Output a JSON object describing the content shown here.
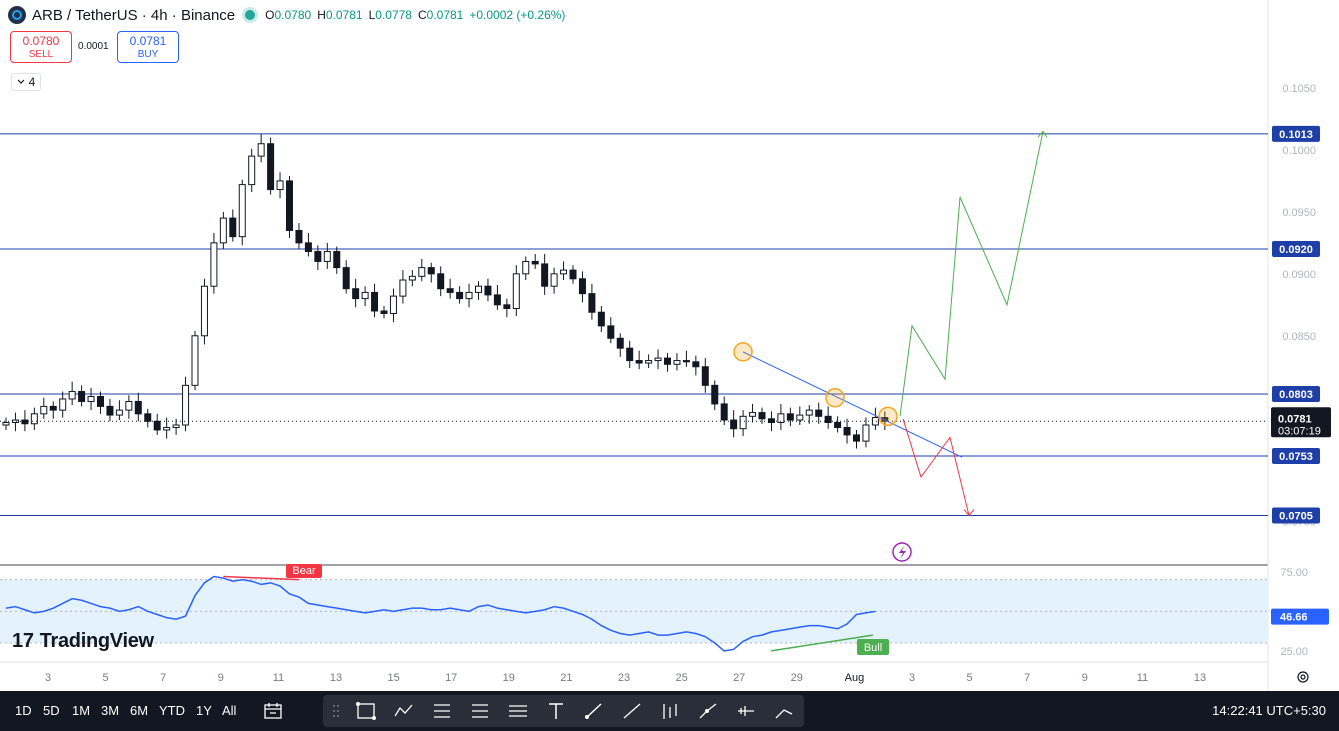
{
  "header": {
    "symbol": "ARB / TetherUS · 4h · Binance",
    "open_label": "O",
    "open": "0.0780",
    "high_label": "H",
    "high": "0.0781",
    "low_label": "L",
    "low": "0.0778",
    "close_label": "C",
    "close": "0.0781",
    "change": "+0.0002 (+0.26%)"
  },
  "trade": {
    "sell_price": "0.0780",
    "sell_label": "SELL",
    "spread": "0.0001",
    "buy_price": "0.0781",
    "buy_label": "BUY"
  },
  "indicator_count": "4",
  "logo_text": "TradingView",
  "colors": {
    "up": "#131722",
    "down": "#131722",
    "level_line": "#1e3fa8",
    "trendline": "#2962ff",
    "bull_path": "#4caf50",
    "bear_path": "#f23645",
    "rsi_line": "#2962ff",
    "rsi_band": "#e3f2fd",
    "circle": "#f5a623",
    "event": "#9c27b0"
  },
  "chart_data": [
    {
      "type": "candlestick",
      "symbol": "ARB / TetherUS",
      "timeframe": "4h",
      "ylim": [
        0.0665,
        0.1075
      ],
      "y_ticks": [
        "0.1050",
        "0.1000",
        "0.0950",
        "0.0900",
        "0.0850",
        "0.0800",
        "0.0750",
        "0.0700"
      ],
      "x_ticks": [
        "3",
        "5",
        "7",
        "9",
        "11",
        "13",
        "15",
        "17",
        "19",
        "21",
        "23",
        "25",
        "27",
        "29",
        "Aug",
        "3",
        "5",
        "7",
        "9",
        "11",
        "13"
      ],
      "key_levels": [
        "0.1013",
        "0.0920",
        "0.0803",
        "0.0753",
        "0.0705"
      ],
      "last_price": "0.0781",
      "countdown": "03:07:19",
      "closes": [
        0.078,
        0.0782,
        0.0779,
        0.0787,
        0.0793,
        0.079,
        0.0799,
        0.0805,
        0.0797,
        0.0801,
        0.0793,
        0.0786,
        0.079,
        0.0797,
        0.0787,
        0.0781,
        0.0774,
        0.0776,
        0.0778,
        0.081,
        0.085,
        0.089,
        0.0925,
        0.0945,
        0.093,
        0.0972,
        0.0995,
        0.1005,
        0.0968,
        0.0975,
        0.0935,
        0.0925,
        0.0918,
        0.091,
        0.0918,
        0.0905,
        0.0888,
        0.088,
        0.0885,
        0.087,
        0.0868,
        0.0882,
        0.0895,
        0.0898,
        0.0905,
        0.09,
        0.0888,
        0.0885,
        0.088,
        0.0885,
        0.089,
        0.0883,
        0.0875,
        0.0872,
        0.09,
        0.091,
        0.0908,
        0.089,
        0.09,
        0.0903,
        0.0896,
        0.0884,
        0.0869,
        0.0858,
        0.0848,
        0.084,
        0.083,
        0.0828,
        0.083,
        0.0832,
        0.0827,
        0.083,
        0.0829,
        0.0825,
        0.081,
        0.0795,
        0.0782,
        0.0775,
        0.0785,
        0.0788,
        0.0783,
        0.078,
        0.0787,
        0.0782,
        0.0786,
        0.079,
        0.0785,
        0.078,
        0.0776,
        0.077,
        0.0765,
        0.0778,
        0.0784,
        0.0781
      ],
      "trendline": {
        "from": [
          0.0837,
          0.0808
        ],
        "to": [
          0.0808,
          0.0752
        ]
      },
      "touch_circles": [
        0.0837,
        0.08,
        0.0785
      ],
      "projection_bull": [
        0.0785,
        0.0858,
        0.0815,
        0.0962,
        0.0875,
        0.1015
      ],
      "projection_bear": [
        0.0783,
        0.0736,
        0.0768,
        0.0705
      ]
    },
    {
      "type": "line",
      "name": "RSI",
      "ylim": [
        18,
        78
      ],
      "y_ticks": [
        "75.00",
        "25.00"
      ],
      "band": [
        30,
        70
      ],
      "last_value": "46.66",
      "values": [
        52,
        53,
        51,
        49,
        50,
        52,
        55,
        58,
        57,
        55,
        53,
        52,
        50,
        51,
        53,
        50,
        48,
        46,
        45,
        47,
        60,
        68,
        72,
        71,
        69,
        70,
        69,
        67,
        68,
        66,
        61,
        59,
        55,
        54,
        53,
        52,
        51,
        50,
        49,
        50,
        51,
        50,
        51,
        52,
        52,
        51,
        51,
        52,
        51,
        50,
        53,
        54,
        52,
        51,
        50,
        49,
        50,
        51,
        53,
        52,
        50,
        48,
        45,
        41,
        38,
        36,
        35,
        36,
        37,
        35,
        35,
        36,
        37,
        36,
        34,
        30,
        25,
        26,
        31,
        34,
        35,
        37,
        38,
        39,
        40,
        41,
        41,
        40,
        39,
        42,
        48,
        49,
        50
      ],
      "divergence_bear_label": "Bear",
      "divergence_bull_label": "Bull"
    }
  ],
  "timeframes": [
    "1D",
    "5D",
    "1M",
    "3M",
    "6M",
    "YTD",
    "1Y",
    "All"
  ],
  "tool_icons": [
    "drag-handle-icon",
    "rectangle-icon",
    "pattern-icon",
    "long-position-icon",
    "short-position-icon",
    "parallel-channel-icon",
    "text-icon",
    "brush-icon",
    "trendline-icon",
    "fib-icon",
    "path-icon",
    "forecast-icon",
    "projection-icon"
  ],
  "clock": "14:22:41 UTC+5:30"
}
